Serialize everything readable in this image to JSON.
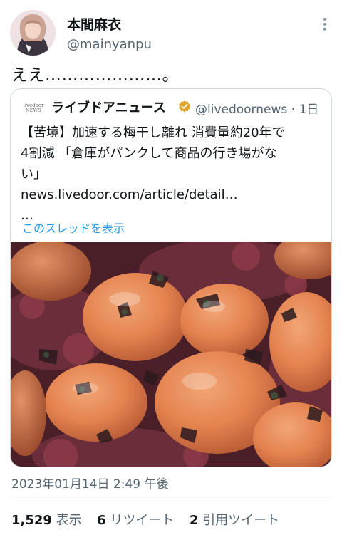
{
  "author": {
    "display_name": "本間麻衣",
    "handle": "@mainyanpu",
    "avatar_icon": "user-avatar"
  },
  "tweet": {
    "text": "ええ…………………。"
  },
  "quote": {
    "logo_line1": "livedoor",
    "logo_line2": "NEWS",
    "name": "ライブドアニュース",
    "verified_color": "#e0a526",
    "handle_time": "@livedoornews · 1日",
    "lines": [
      "【苦境】加速する梅干し離れ 消費量約20年で",
      "4割減 「倉庫がパンクして商品の行き場がな",
      "い」",
      "news.livedoor.com/article/detail…",
      "…"
    ],
    "thread_link": "このスレッドを表示"
  },
  "timestamp": "2023年01月14日 2:49 午後",
  "stats": {
    "views_count": "1,529",
    "views_label": "表示",
    "retweets_count": "6",
    "retweets_label": "リツイート",
    "quotes_count": "2",
    "quotes_label": "引用ツイート"
  },
  "colors": {
    "link": "#1d9bf0",
    "secondary_text": "#536471",
    "border": "#cfd9de"
  }
}
